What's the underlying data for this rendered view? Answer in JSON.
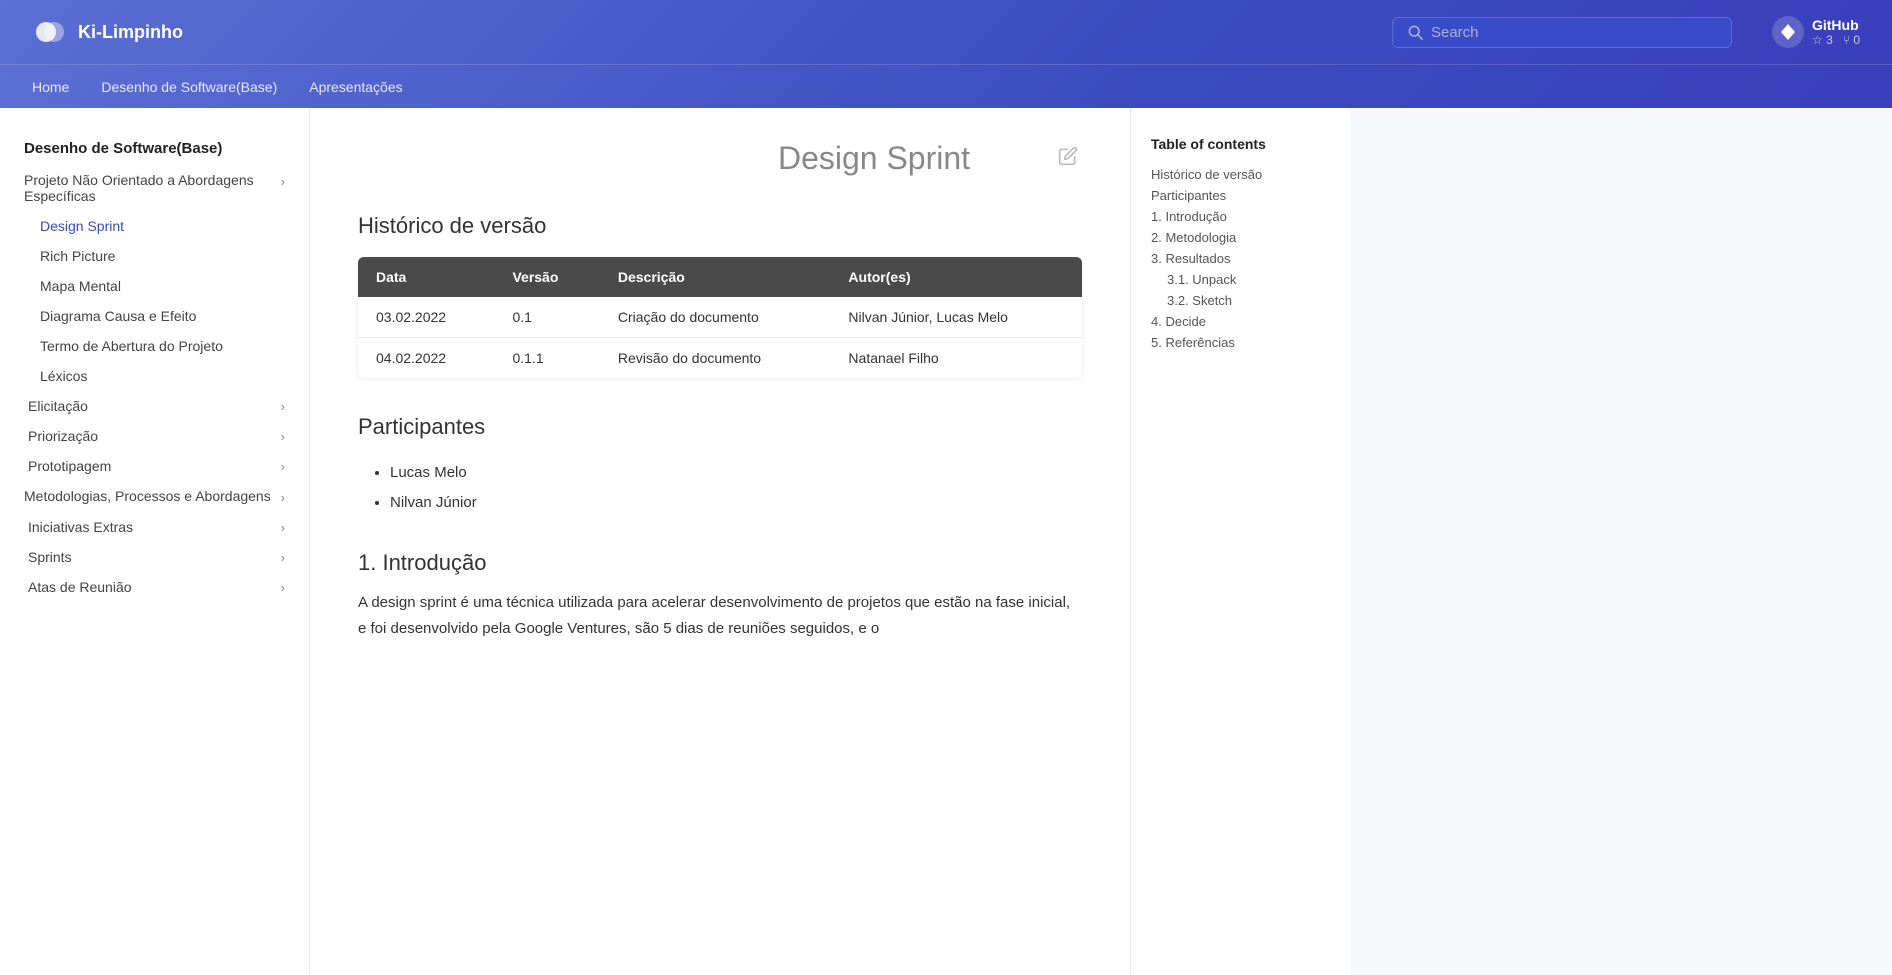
{
  "topNav": {
    "logo_text": "Ki-Limpinho",
    "search_placeholder": "Search",
    "github_label": "GitHub",
    "github_stars": "3",
    "github_forks": "0"
  },
  "subNav": {
    "items": [
      {
        "label": "Home",
        "href": "#"
      },
      {
        "label": "Desenho de Software(Base)",
        "href": "#"
      },
      {
        "label": "Apresentações",
        "href": "#"
      }
    ]
  },
  "sidebar": {
    "section_title": "Desenho de Software(Base)",
    "items": [
      {
        "label": "Projeto Não Orientado a Abordagens Específicas",
        "has_chevron": true,
        "indent": false
      },
      {
        "label": "Design Sprint",
        "active": true,
        "indent": true
      },
      {
        "label": "Rich Picture",
        "active": false,
        "indent": true
      },
      {
        "label": "Mapa Mental",
        "active": false,
        "indent": true
      },
      {
        "label": "Diagrama Causa e Efeito",
        "active": false,
        "indent": true
      },
      {
        "label": "Termo de Abertura do Projeto",
        "active": false,
        "indent": true
      },
      {
        "label": "Léxicos",
        "active": false,
        "indent": true
      },
      {
        "label": "Elicitação",
        "has_chevron": true,
        "indent": false
      },
      {
        "label": "Priorização",
        "has_chevron": true,
        "indent": false
      },
      {
        "label": "Prototipagem",
        "has_chevron": true,
        "indent": false
      },
      {
        "label": "Metodologias, Processos e Abordagens",
        "has_chevron": true,
        "indent": false
      },
      {
        "label": "Iniciativas Extras",
        "has_chevron": true,
        "indent": false
      },
      {
        "label": "Sprints",
        "has_chevron": true,
        "indent": false
      },
      {
        "label": "Atas de Reunião",
        "has_chevron": true,
        "indent": false
      }
    ]
  },
  "main": {
    "page_title": "Design Sprint",
    "historico_heading": "Histórico de versão",
    "table": {
      "headers": [
        "Data",
        "Versão",
        "Descrição",
        "Autor(es)"
      ],
      "rows": [
        {
          "data": "03.02.2022",
          "versao": "0.1",
          "descricao": "Criação do documento",
          "autores": "Nilvan Júnior, Lucas Melo"
        },
        {
          "data": "04.02.2022",
          "versao": "0.1.1",
          "descricao": "Revisão do documento",
          "autores": "Natanael Filho"
        }
      ]
    },
    "participantes_heading": "Participantes",
    "participantes": [
      "Lucas Melo",
      "Nilvan Júnior"
    ],
    "intro_heading": "1. Introdução",
    "intro_text": "A design sprint é uma técnica utilizada para acelerar desenvolvimento de projetos que estão na fase inicial, e foi desenvolvido pela Google Ventures, são 5 dias de reuniões seguidos, e o"
  },
  "toc": {
    "title": "Table of contents",
    "items": [
      {
        "label": "Histórico de versão",
        "sub": false
      },
      {
        "label": "Participantes",
        "sub": false
      },
      {
        "label": "1. Introdução",
        "sub": false
      },
      {
        "label": "2. Metodologia",
        "sub": false
      },
      {
        "label": "3. Resultados",
        "sub": false
      },
      {
        "label": "3.1. Unpack",
        "sub": true
      },
      {
        "label": "3.2. Sketch",
        "sub": true
      },
      {
        "label": "4. Decide",
        "sub": false
      },
      {
        "label": "5. Referências",
        "sub": false
      }
    ]
  }
}
